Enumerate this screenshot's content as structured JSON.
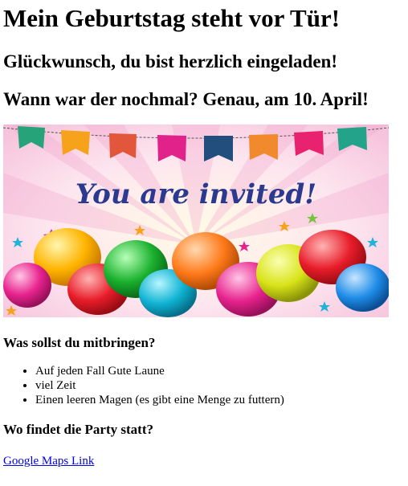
{
  "page": {
    "title": "Mein Geburtstag steht vor Tür!",
    "subtitle": "Glückwunsch, du bist herzlich eingeladen!",
    "date_line": "Wann war der nochmal? Genau, am 10. April!",
    "banner": {
      "text": "You are invited!"
    },
    "bring_heading": "Was sollst du mitbringen?",
    "bring_items": [
      "Auf jeden Fall Gute Laune",
      "viel Zeit",
      "Einen leeren Magen (es gibt eine Menge zu futtern)"
    ],
    "location_heading": "Wo findet die Party statt?",
    "map_link": "Google Maps Link"
  }
}
